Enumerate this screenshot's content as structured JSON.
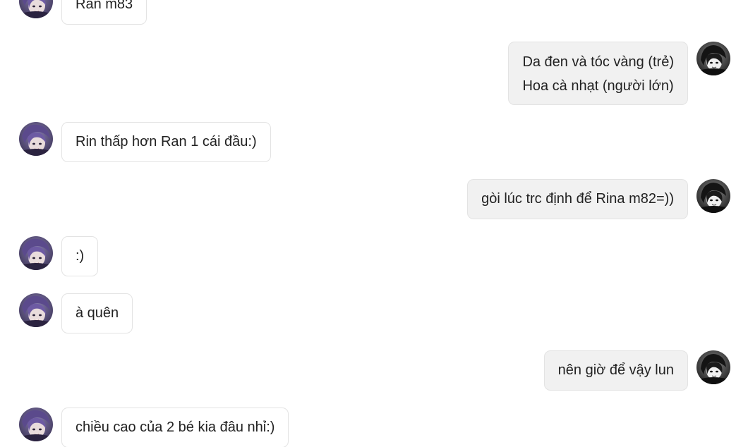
{
  "messages": [
    {
      "side": "incoming",
      "lines": [
        "Ran m83"
      ]
    },
    {
      "side": "outgoing",
      "lines": [
        "Da đen và tóc vàng (trẻ)",
        "Hoa cà nhạt (người lớn)"
      ]
    },
    {
      "side": "incoming",
      "lines": [
        "Rin thấp hơn Ran 1 cái đầu:)"
      ]
    },
    {
      "side": "outgoing",
      "lines": [
        "gòi lúc trc định để Rina m82=))"
      ]
    },
    {
      "side": "incoming",
      "lines": [
        ":)"
      ]
    },
    {
      "side": "incoming",
      "lines": [
        "à quên"
      ]
    },
    {
      "side": "outgoing",
      "lines": [
        "nên giờ để vậy lun"
      ]
    },
    {
      "side": "incoming",
      "lines": [
        "chiều cao của 2 bé kia đâu nhỉ:)"
      ]
    }
  ],
  "colors": {
    "incoming_bubble": "#ffffff",
    "outgoing_bubble": "#f1f1f1",
    "bubble_border": "#e3e3e3",
    "text": "#222222"
  },
  "icons": {
    "incoming_avatar": "purple-hair-avatar-icon",
    "outgoing_avatar": "dark-hair-avatar-icon"
  }
}
